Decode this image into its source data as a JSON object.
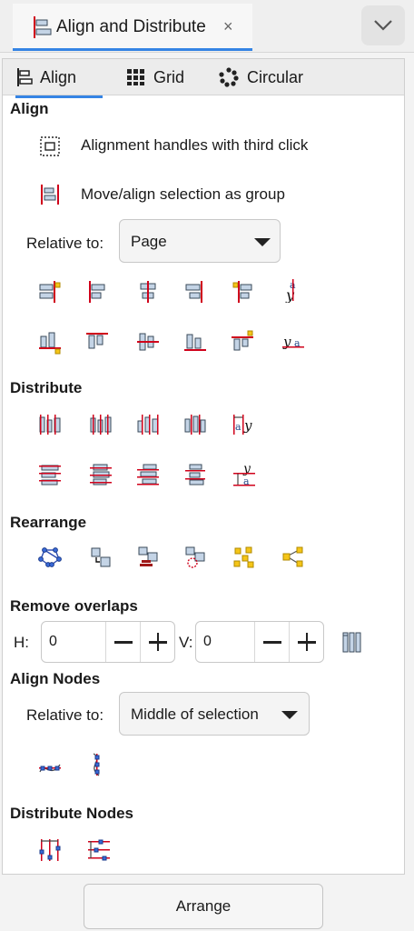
{
  "header": {
    "tab_title": "Align and Distribute",
    "close_glyph": "×"
  },
  "subtabs": [
    {
      "label": "Align",
      "icon": "align-icon",
      "active": true
    },
    {
      "label": "Grid",
      "icon": "grid-icon",
      "active": false
    },
    {
      "label": "Circular",
      "icon": "circular-icon",
      "active": false
    }
  ],
  "align": {
    "title": "Align",
    "option_handles": "Alignment handles with third click",
    "option_group": "Move/align selection as group",
    "relative_label": "Relative to:",
    "relative_value": "Page"
  },
  "distribute": {
    "title": "Distribute"
  },
  "rearrange": {
    "title": "Rearrange"
  },
  "overlaps": {
    "title": "Remove overlaps",
    "h_label": "H:",
    "h_value": "0",
    "v_label": "V:",
    "v_value": "0"
  },
  "align_nodes": {
    "title": "Align Nodes",
    "relative_label": "Relative to:",
    "relative_value": "Middle of selection"
  },
  "distribute_nodes": {
    "title": "Distribute Nodes"
  },
  "footer": {
    "arrange_label": "Arrange"
  },
  "colors": {
    "accent": "#3584e4",
    "guide": "#d0021b",
    "box_fill": "#c4d4e6",
    "box_stroke": "#3a4a5a"
  }
}
